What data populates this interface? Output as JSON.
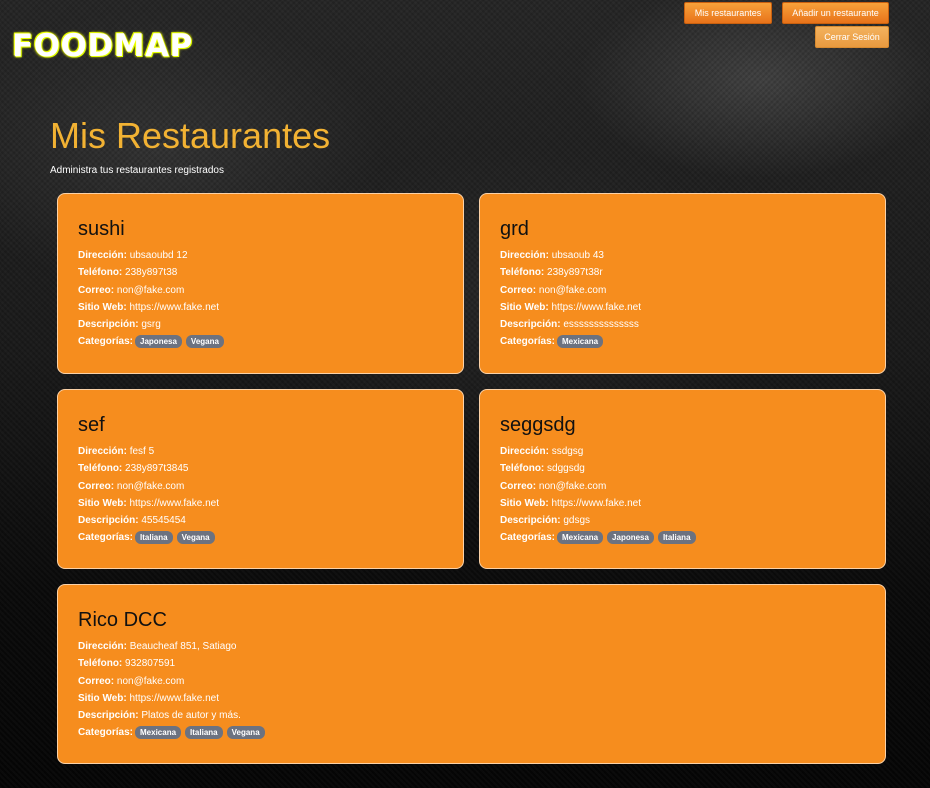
{
  "header": {
    "logo": "FOODMAP",
    "nav": {
      "mis_restaurantes": "Mis restaurantes",
      "anadir": "Añadir un restaurante",
      "cerrar_sesion": "Cerrar Sesión"
    }
  },
  "page": {
    "title": "Mis Restaurantes",
    "subtitle": "Administra tus restaurantes registrados"
  },
  "labels": {
    "direccion": "Dirección:",
    "telefono": "Teléfono:",
    "correo": "Correo:",
    "sitio_web": "Sitio Web:",
    "descripcion": "Descripción:",
    "categorias": "Categorías:"
  },
  "restaurants": [
    {
      "name": "sushi",
      "direccion": "ubsaoubd 12",
      "telefono": "238y897t38",
      "correo": "non@fake.com",
      "sitio_web": "https://www.fake.net",
      "descripcion": "gsrg",
      "categorias": [
        "Japonesa",
        "Vegana"
      ]
    },
    {
      "name": "grd",
      "direccion": "ubsaoub 43",
      "telefono": "238y897t38r",
      "correo": "non@fake.com",
      "sitio_web": "https://www.fake.net",
      "descripcion": "essssssssssssss",
      "categorias": [
        "Mexicana"
      ]
    },
    {
      "name": "sef",
      "direccion": "fesf 5",
      "telefono": "238y897t3845",
      "correo": "non@fake.com",
      "sitio_web": "https://www.fake.net",
      "descripcion": "45545454",
      "categorias": [
        "Italiana",
        "Vegana"
      ]
    },
    {
      "name": "seggsdg",
      "direccion": "ssdgsg",
      "telefono": "sdggsdg",
      "correo": "non@fake.com",
      "sitio_web": "https://www.fake.net",
      "descripcion": "gdsgs",
      "categorias": [
        "Mexicana",
        "Japonesa",
        "Italiana"
      ]
    },
    {
      "name": "Rico DCC",
      "direccion": "Beaucheaf 851, Satiago",
      "telefono": "932807591",
      "correo": "non@fake.com",
      "sitio_web": "https://www.fake.net",
      "descripcion": "Platos de autor y más.",
      "categorias": [
        "Mexicana",
        "Italiana",
        "Vegana"
      ]
    }
  ],
  "colors": {
    "card_bg": "#f68d1e",
    "title": "#f2b233",
    "tag_bg": "#6c7280",
    "logo_glow": "#e9ff00"
  }
}
